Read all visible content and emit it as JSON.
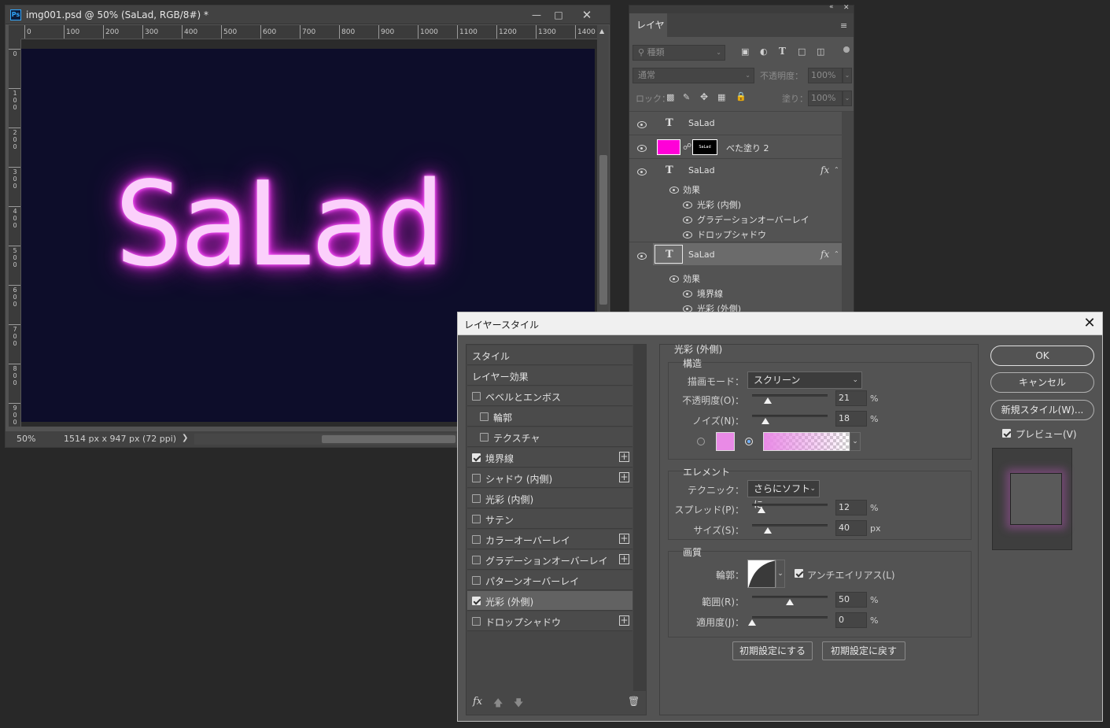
{
  "document": {
    "title": "img001.psd @ 50% (SaLad, RGB/8#) *",
    "ps_badge": "Ps",
    "ruler_h": [
      "0",
      "100",
      "200",
      "300",
      "400",
      "500",
      "600",
      "700",
      "800",
      "900",
      "1000",
      "1100",
      "1200",
      "1300",
      "1400"
    ],
    "ruler_v": [
      "0",
      "100",
      "200",
      "300",
      "400",
      "500",
      "600",
      "700",
      "800",
      "900"
    ],
    "canvas_text": "SaLad",
    "zoom": "50%",
    "info": "1514 px x 947 px (72 ppi)",
    "colors": {
      "canvas_bg": "#0d0d2a",
      "glow": "#ff3bff"
    }
  },
  "layers_panel": {
    "tab": "レイヤー",
    "search_placeholder": "種類",
    "blend_mode": "通常",
    "opacity_label": "不透明度：",
    "opacity_value": "100%",
    "lock_label": "ロック：",
    "fill_label": "塗り：",
    "fill_value": "100%",
    "layers": [
      {
        "name": "SaLad",
        "type": "text"
      },
      {
        "name": "べた塗り 2",
        "type": "fill",
        "swatch": "#ff00d8"
      },
      {
        "name": "SaLad",
        "type": "text",
        "effects_label": "効果",
        "effects": [
          "光彩 (内側)",
          "グラデーションオーバーレイ",
          "ドロップシャドウ"
        ]
      },
      {
        "name": "SaLad",
        "type": "text",
        "effects_label": "効果",
        "effects": [
          "境界線",
          "光彩 (外側)"
        ]
      }
    ]
  },
  "dialog": {
    "title": "レイヤースタイル",
    "styles_header": "スタイル",
    "layer_effects": "レイヤー効果",
    "items": [
      {
        "label": "ベベルとエンボス",
        "checked": false,
        "plus": false,
        "indent": false
      },
      {
        "label": "輪郭",
        "checked": false,
        "plus": false,
        "indent": true
      },
      {
        "label": "テクスチャ",
        "checked": false,
        "plus": false,
        "indent": true
      },
      {
        "label": "境界線",
        "checked": true,
        "plus": true,
        "indent": false
      },
      {
        "label": "シャドウ (内側)",
        "checked": false,
        "plus": true,
        "indent": false
      },
      {
        "label": "光彩 (内側)",
        "checked": false,
        "plus": false,
        "indent": false
      },
      {
        "label": "サテン",
        "checked": false,
        "plus": false,
        "indent": false
      },
      {
        "label": "カラーオーバーレイ",
        "checked": false,
        "plus": true,
        "indent": false
      },
      {
        "label": "グラデーションオーバーレイ",
        "checked": false,
        "plus": true,
        "indent": false
      },
      {
        "label": "パターンオーバーレイ",
        "checked": false,
        "plus": false,
        "indent": false
      },
      {
        "label": "光彩 (外側)",
        "checked": true,
        "plus": false,
        "indent": false,
        "selected": true
      },
      {
        "label": "ドロップシャドウ",
        "checked": false,
        "plus": true,
        "indent": false
      }
    ],
    "section_title": "光彩 (外側)",
    "structure": {
      "title": "構造",
      "blend_label": "描画モード：",
      "blend_value": "スクリーン",
      "opacity_label": "不透明度(O)：",
      "opacity_value": "21",
      "noise_label": "ノイズ(N)：",
      "noise_value": "18",
      "unit_pct": "%",
      "color": "#e98ae6"
    },
    "elements": {
      "title": "エレメント",
      "technique_label": "テクニック：",
      "technique_value": "さらにソフトに",
      "spread_label": "スプレッド(P)：",
      "spread_value": "12",
      "size_label": "サイズ(S)：",
      "size_value": "40",
      "unit_pct": "%",
      "unit_px": "px"
    },
    "quality": {
      "title": "画質",
      "contour_label": "輪郭：",
      "antialias_label": "アンチエイリアス(L)",
      "range_label": "範囲(R)：",
      "range_value": "50",
      "jitter_label": "適用度(J)：",
      "jitter_value": "0",
      "unit_pct": "%"
    },
    "make_default": "初期設定にする",
    "reset_default": "初期設定に戻す",
    "ok": "OK",
    "cancel": "キャンセル",
    "new_style": "新規スタイル(W)...",
    "preview_label": "プレビュー(V)",
    "footer_fx": "fx"
  }
}
